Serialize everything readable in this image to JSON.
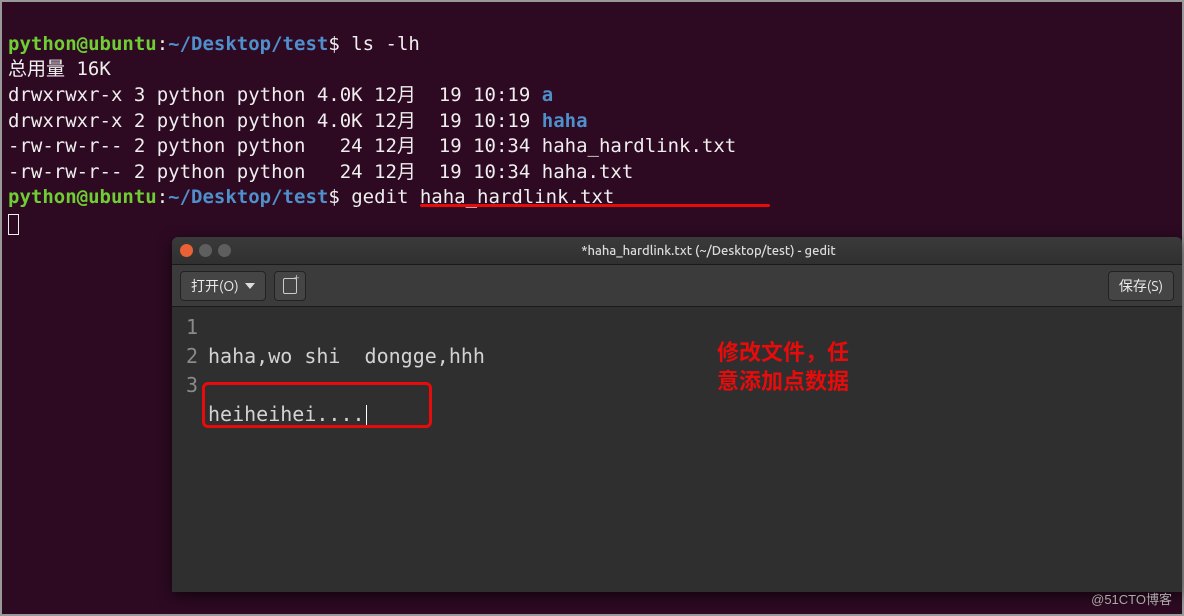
{
  "terminal": {
    "user": "python@ubuntu",
    "colon": ":",
    "path": "~/Desktop/test",
    "dollar": "$",
    "cmd1": " ls -lh",
    "total_label": "总用量 16K",
    "rows": [
      {
        "perm": "drwxrwxr-x 3 python python 4.0K 12月  19 10:19 ",
        "name": "a",
        "dir": true
      },
      {
        "perm": "drwxrwxr-x 2 python python 4.0K 12月  19 10:19 ",
        "name": "haha",
        "dir": true
      },
      {
        "perm": "-rw-rw-r-- 2 python python   24 12月  19 10:34 ",
        "name": "haha_hardlink.txt",
        "dir": false
      },
      {
        "perm": "-rw-rw-r-- 2 python python   24 12月  19 10:34 ",
        "name": "haha.txt",
        "dir": false
      }
    ],
    "cmd2": " gedit haha_hardlink.txt"
  },
  "gedit": {
    "title": "*haha_hardlink.txt (~/Desktop/test) - gedit",
    "open_label": "打开(O)",
    "save_label": "保存(S)",
    "lines": {
      "n1": "1",
      "n2": "2",
      "n3": "3",
      "l1": "haha,wo shi  dongge,hhh",
      "l2": "",
      "l3": "heiheihei...."
    }
  },
  "annotation": {
    "text": "修改文件，任\n意添加点数据"
  },
  "watermark": "@51CTO博客"
}
